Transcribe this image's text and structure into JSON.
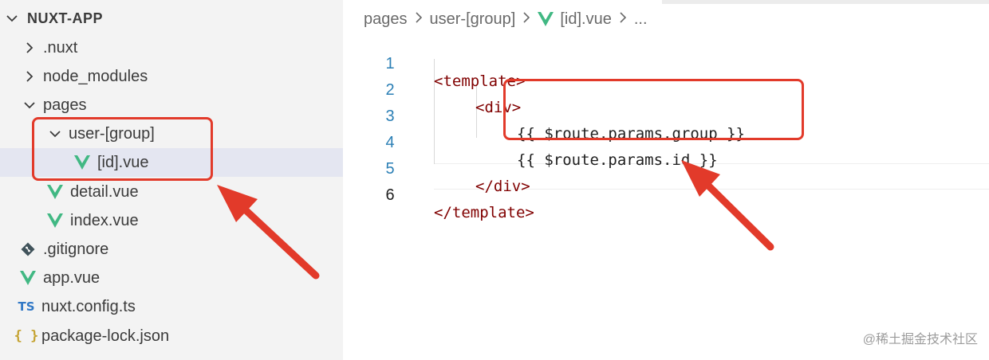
{
  "explorer": {
    "root": "NUXT-APP",
    "items": [
      {
        "label": ".nuxt",
        "kind": "folder"
      },
      {
        "label": "node_modules",
        "kind": "folder"
      },
      {
        "label": "pages",
        "kind": "folder"
      },
      {
        "label": "user-[group]",
        "kind": "folder"
      },
      {
        "label": "[id].vue",
        "kind": "vue"
      },
      {
        "label": "detail.vue",
        "kind": "vue"
      },
      {
        "label": "index.vue",
        "kind": "vue"
      },
      {
        "label": ".gitignore",
        "kind": "git"
      },
      {
        "label": "app.vue",
        "kind": "vue"
      },
      {
        "label": "nuxt.config.ts",
        "kind": "ts",
        "icon_text": "TS"
      },
      {
        "label": "package-lock.json",
        "kind": "json",
        "icon_text": "{ }"
      }
    ]
  },
  "editor": {
    "breadcrumb": [
      "pages",
      "user-[group]",
      "[id].vue",
      "..."
    ],
    "line_numbers": [
      "1",
      "2",
      "3",
      "4",
      "5",
      "6"
    ],
    "lines": {
      "l1": "<template>",
      "l2": "<div>",
      "l3_open": "{{",
      "l3_expr": " $route.params.group ",
      "l3_close": "}}",
      "l4_open": "{{",
      "l4_expr": " $route.params.id ",
      "l4_close": "}}",
      "l5": "</div>",
      "l6": "</template>"
    }
  },
  "watermark": "@稀土掘金技术社区",
  "colors": {
    "annotation": "#e23a2a",
    "vue_green": "#41b883",
    "tag": "#800000",
    "line_number": "#2b7fb5"
  }
}
